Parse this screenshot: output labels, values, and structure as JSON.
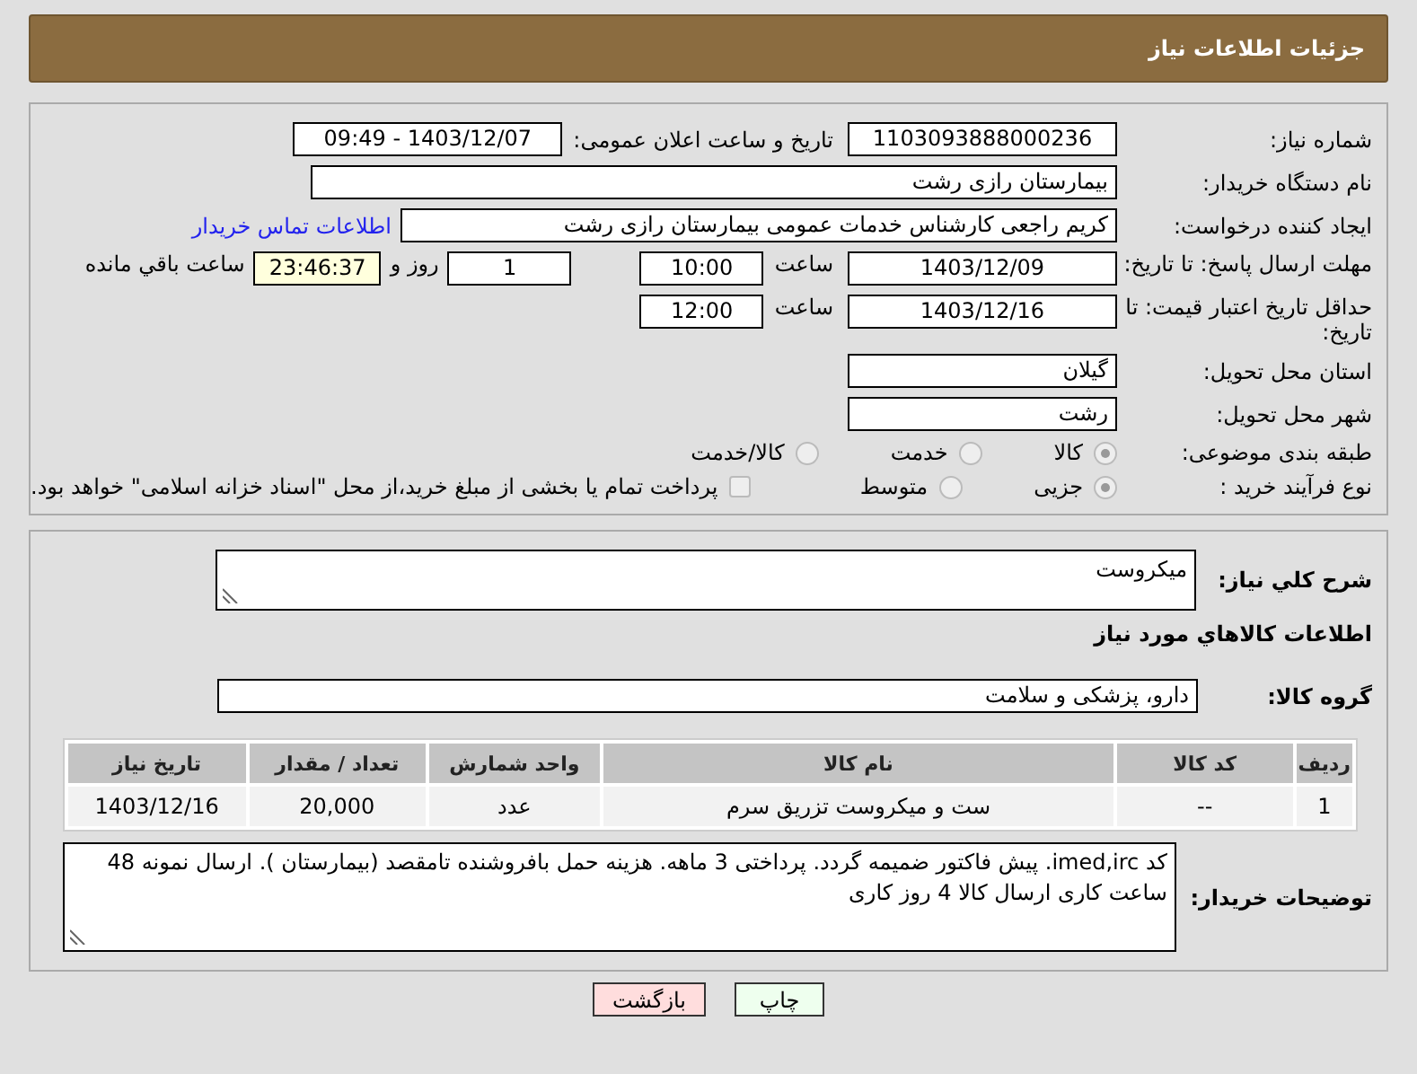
{
  "header": {
    "title": "جزئیات اطلاعات نیاز"
  },
  "need_info": {
    "need_number": {
      "label": "شماره نیاز:",
      "value": "1103093888000236"
    },
    "announce": {
      "label": "تاریخ و ساعت اعلان عمومی:",
      "value": "1403/12/07 - 09:49"
    },
    "buyer_org": {
      "label": "نام دستگاه خریدار:",
      "value": "بیمارستان رازی رشت"
    },
    "requester": {
      "label": "ایجاد کننده درخواست:",
      "value": "کریم راجعی کارشناس خدمات عمومی بیمارستان رازی رشت",
      "link": "اطلاعات تماس خریدار"
    },
    "response_deadline": {
      "label": "مهلت ارسال پاسخ: تا تاریخ:",
      "date": "1403/12/09",
      "time_label": "ساعت",
      "time": "10:00",
      "days": "1",
      "days_label": "روز و",
      "remaining": "23:46:37",
      "remaining_label": "ساعت باقي مانده"
    },
    "price_validity": {
      "label": "حداقل تاریخ اعتبار قیمت: تا تاریخ:",
      "date": "1403/12/16",
      "time_label": "ساعت",
      "time": "12:00"
    },
    "province": {
      "label": "استان محل تحویل:",
      "value": "گیلان"
    },
    "city": {
      "label": "شهر محل تحویل:",
      "value": "رشت"
    },
    "category": {
      "label": "طبقه بندی موضوعی:",
      "options": [
        {
          "label": "کالا",
          "selected": true
        },
        {
          "label": "خدمت",
          "selected": false
        },
        {
          "label": "کالا/خدمت",
          "selected": false
        }
      ]
    },
    "purchase_type": {
      "label": "نوع فرآیند خرید :",
      "options": [
        {
          "label": "جزیی",
          "selected": true
        },
        {
          "label": "متوسط",
          "selected": false
        }
      ],
      "payment_note": {
        "label": "پرداخت تمام یا بخشی از مبلغ خرید،از محل \"اسناد خزانه اسلامی\" خواهد بود.",
        "checked": false
      }
    }
  },
  "goods": {
    "description": {
      "label": "شرح کلي نياز:",
      "value": "میکروست"
    },
    "heading": "اطلاعات کالاهاي مورد نياز",
    "group": {
      "label": "گروه کالا:",
      "value": "دارو، پزشکی و سلامت"
    },
    "table": {
      "columns": [
        "رديف",
        "کد کالا",
        "نام کالا",
        "واحد شمارش",
        "تعداد / مقدار",
        "تاریخ نیاز"
      ],
      "rows": [
        [
          "1",
          "--",
          "ست و میکروست تزریق سرم",
          "عدد",
          "20,000",
          "1403/12/16"
        ]
      ]
    },
    "buyer_notes": {
      "label": "توضیحات خریدار:",
      "value": "کد imed,irc. پیش فاکتور ضمیمه گردد. پرداختی 3 ماهه. هزینه حمل بافروشنده تامقصد (بیمارستان ). ارسال نمونه 48 ساعت کاری ارسال کالا 4 روز کاری"
    }
  },
  "buttons": [
    {
      "label": "چاپ",
      "kind": "print"
    },
    {
      "label": "بازگشت",
      "kind": "back"
    }
  ]
}
